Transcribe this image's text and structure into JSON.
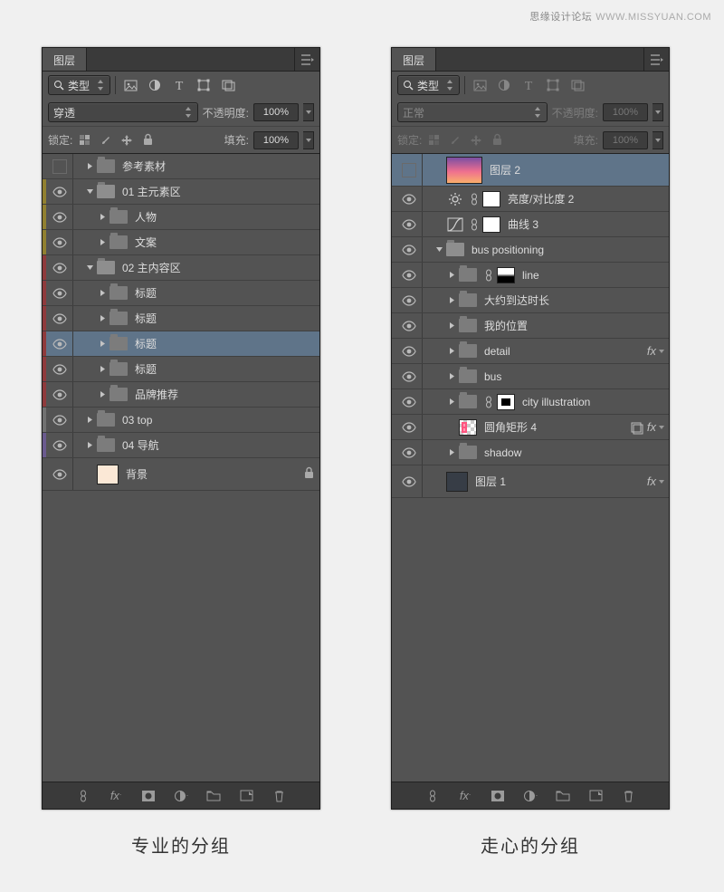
{
  "watermark": {
    "name": "思缘设计论坛",
    "url": "WWW.MISSYUAN.COM"
  },
  "left": {
    "caption": "专业的分组",
    "panel_title": "图层",
    "filter_label": "类型",
    "blend_mode": "穿透",
    "opacity_label": "不透明度:",
    "opacity_value": "100%",
    "lock_label": "锁定:",
    "fill_label": "填充:",
    "fill_value": "100%",
    "layers": [
      {
        "color": "none",
        "vis": "empty",
        "indent": 1,
        "tri": "right",
        "kind": "folder",
        "name": "参考素材"
      },
      {
        "color": "gold",
        "vis": "eye",
        "indent": 1,
        "tri": "down",
        "kind": "folder-open",
        "name": "01 主元素区"
      },
      {
        "color": "gold",
        "vis": "eye",
        "indent": 2,
        "tri": "right",
        "kind": "folder",
        "name": "人物"
      },
      {
        "color": "gold",
        "vis": "eye",
        "indent": 2,
        "tri": "right",
        "kind": "folder",
        "name": "文案"
      },
      {
        "color": "red",
        "vis": "eye",
        "indent": 1,
        "tri": "down",
        "kind": "folder-open",
        "name": "02 主内容区"
      },
      {
        "color": "red",
        "vis": "eye",
        "indent": 2,
        "tri": "right",
        "kind": "folder",
        "name": "标题"
      },
      {
        "color": "red",
        "vis": "eye",
        "indent": 2,
        "tri": "right",
        "kind": "folder",
        "name": "标题"
      },
      {
        "color": "red",
        "vis": "eye",
        "indent": 2,
        "tri": "right",
        "kind": "folder",
        "name": "标题",
        "sel": true
      },
      {
        "color": "red",
        "vis": "eye",
        "indent": 2,
        "tri": "right",
        "kind": "folder",
        "name": "标题"
      },
      {
        "color": "red",
        "vis": "eye",
        "indent": 2,
        "tri": "right",
        "kind": "folder",
        "name": "品牌推荐"
      },
      {
        "color": "gray",
        "vis": "eye",
        "indent": 1,
        "tri": "right",
        "kind": "folder",
        "name": "03 top"
      },
      {
        "color": "purple",
        "vis": "eye",
        "indent": 1,
        "tri": "right",
        "kind": "folder",
        "name": "04 导航"
      },
      {
        "color": "none",
        "vis": "eye",
        "indent": 1,
        "tri": "",
        "kind": "bg",
        "name": "背景",
        "locked": true,
        "tall": true
      }
    ]
  },
  "right": {
    "caption": "走心的分组",
    "panel_title": "图层",
    "filter_label": "类型",
    "blend_mode": "正常",
    "opacity_label": "不透明度:",
    "opacity_value": "100%",
    "lock_label": "锁定:",
    "fill_label": "填充:",
    "fill_value": "100%",
    "dimmed": true,
    "layers": [
      {
        "vis": "empty",
        "indent": 1,
        "tri": "",
        "kind": "img-big",
        "name": "图层 2",
        "sel": true,
        "tall": true
      },
      {
        "vis": "eye",
        "indent": 1,
        "tri": "",
        "kind": "adj-sun",
        "name": "亮度/对比度 2"
      },
      {
        "vis": "eye",
        "indent": 1,
        "tri": "",
        "kind": "adj-curve",
        "name": "曲线 3"
      },
      {
        "vis": "eye",
        "indent": 1,
        "tri": "down",
        "kind": "folder-open",
        "name": "bus positioning"
      },
      {
        "vis": "eye",
        "indent": 2,
        "tri": "right",
        "kind": "folder-mask-grad",
        "name": "line"
      },
      {
        "vis": "eye",
        "indent": 2,
        "tri": "right",
        "kind": "folder",
        "name": "大约到达时长"
      },
      {
        "vis": "eye",
        "indent": 2,
        "tri": "right",
        "kind": "folder",
        "name": "我的位置"
      },
      {
        "vis": "eye",
        "indent": 2,
        "tri": "right",
        "kind": "folder",
        "name": "detail",
        "fx": true
      },
      {
        "vis": "eye",
        "indent": 2,
        "tri": "right",
        "kind": "folder",
        "name": "bus"
      },
      {
        "vis": "eye",
        "indent": 2,
        "tri": "right",
        "kind": "folder-mask-box",
        "name": "city illustration"
      },
      {
        "vis": "eye",
        "indent": 2,
        "tri": "",
        "kind": "shape-pink",
        "name": "圆角矩形 4",
        "fx": true,
        "smart": true
      },
      {
        "vis": "eye",
        "indent": 2,
        "tri": "right",
        "kind": "folder",
        "name": "shadow"
      },
      {
        "vis": "eye",
        "indent": 1,
        "tri": "",
        "kind": "img-dark",
        "name": "图层 1",
        "fx": true,
        "tall": true
      }
    ]
  }
}
